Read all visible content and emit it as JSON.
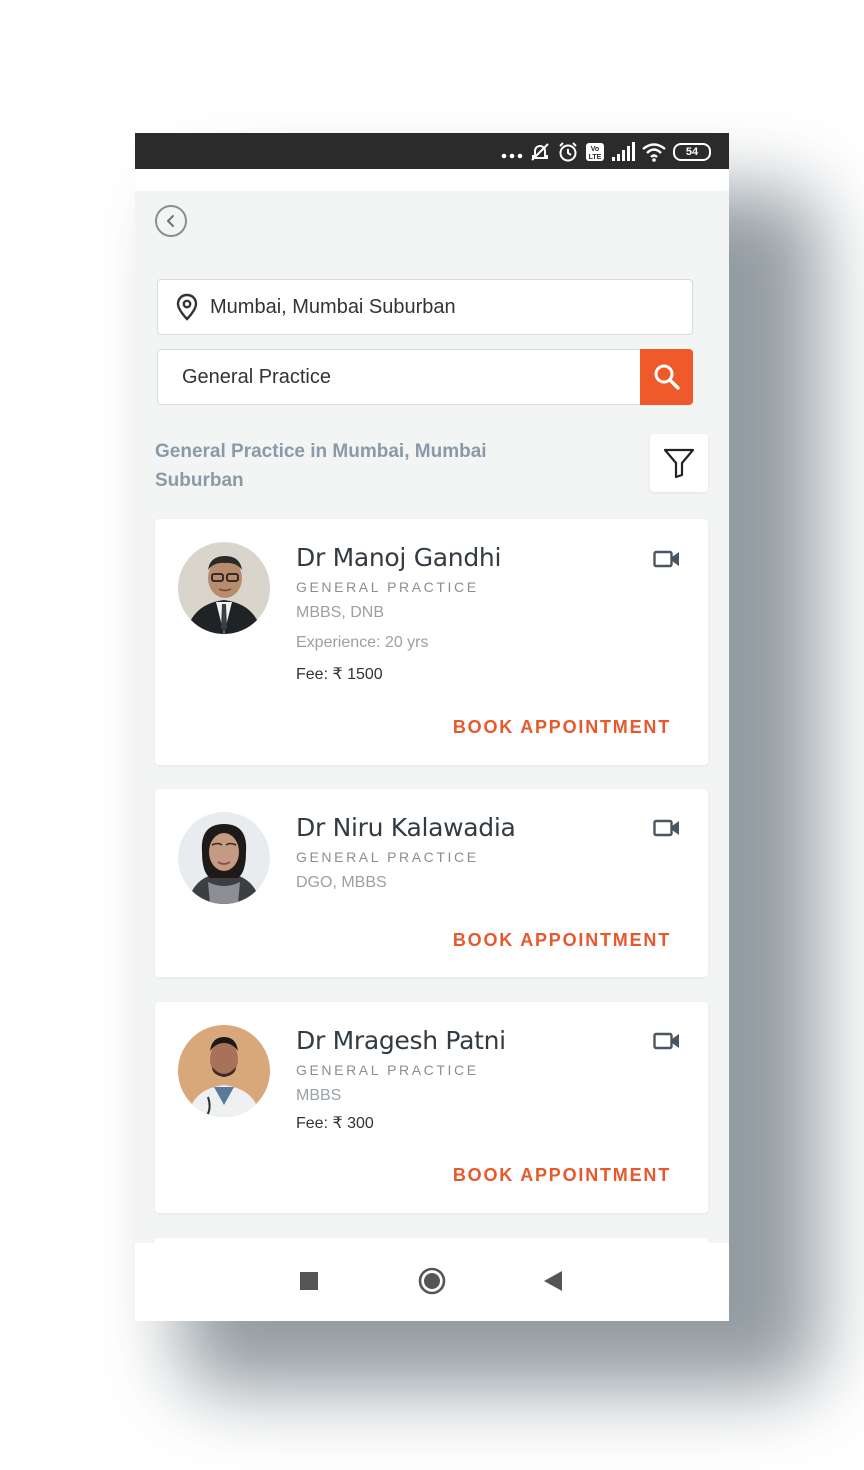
{
  "statusbar": {
    "battery": "54"
  },
  "search": {
    "location_value": "Mumbai, Mumbai Suburban",
    "specialty_value": "General Practice"
  },
  "results": {
    "heading_line1": "General Practice in Mumbai, Mumbai",
    "heading_line2": "Suburban"
  },
  "doctors": [
    {
      "name": "Dr Manoj Gandhi",
      "specialty": "GENERAL PRACTICE",
      "qualification": "MBBS, DNB",
      "experience": "Experience: 20 yrs",
      "fee": "Fee: ₹ 1500",
      "book_label": "BOOK APPOINTMENT"
    },
    {
      "name": "Dr Niru Kalawadia",
      "specialty": "GENERAL PRACTICE",
      "qualification": "DGO, MBBS",
      "book_label": "BOOK APPOINTMENT"
    },
    {
      "name": "Dr Mragesh Patni",
      "specialty": "GENERAL PRACTICE",
      "qualification": "MBBS",
      "fee": "Fee: ₹ 300",
      "book_label": "BOOK APPOINTMENT"
    }
  ],
  "colors": {
    "accent": "#ef5a2a",
    "heading": "#8a9aa9",
    "statusbar": "#2b2b2b"
  },
  "icons": {
    "back": "chevron-left-icon",
    "location": "location-pin-icon",
    "search": "search-icon",
    "filter": "filter-icon",
    "video": "video-camera-icon"
  }
}
